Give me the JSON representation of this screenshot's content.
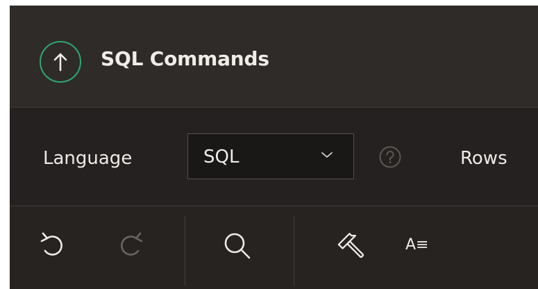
{
  "header": {
    "title": "SQL Commands",
    "back_icon": "arrow-up-circle-icon",
    "accent_color": "#2fa870"
  },
  "settings": {
    "language_label": "Language",
    "language_value": "SQL",
    "rows_label": "Rows"
  },
  "toolbar": {
    "format_label": "A≡"
  }
}
